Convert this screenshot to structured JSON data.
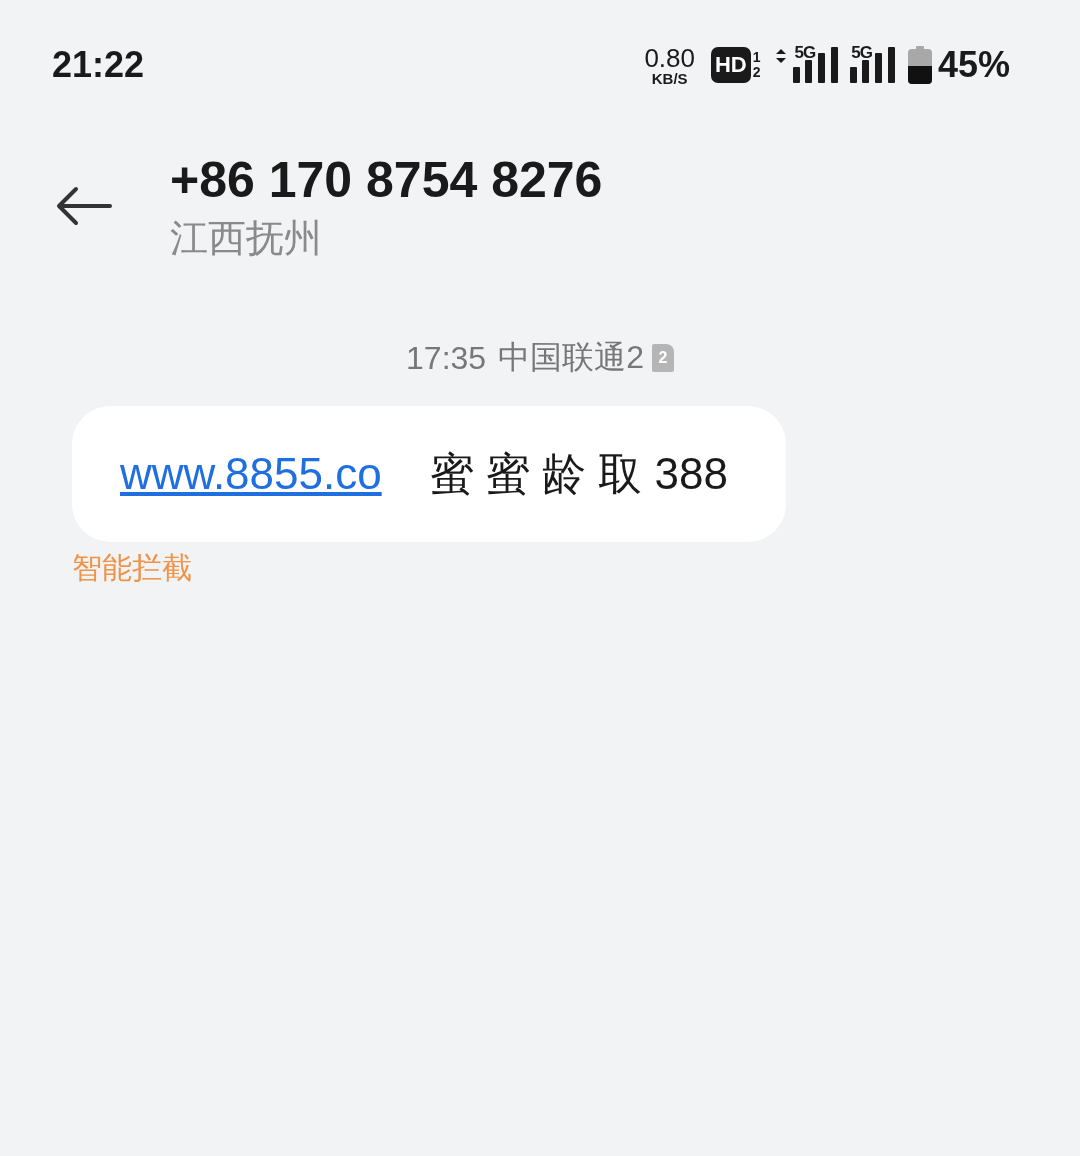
{
  "status_bar": {
    "time": "21:22",
    "net_speed": "0.80",
    "net_unit": "KB/S",
    "hd": "HD",
    "hd_sim_1": "1",
    "hd_sim_2": "2",
    "sim_1_network": "5G",
    "sim_2_network": "5G",
    "battery": "45%"
  },
  "header": {
    "title": "+86 170 8754 8276",
    "subtitle": "江西抚州"
  },
  "messages": [
    {
      "timestamp": "17:35",
      "carrier": "中国联通2",
      "sim": "2",
      "link": "www.8855.co",
      "text": "蜜 蜜 龄 取 388",
      "label": "智能拦截"
    }
  ]
}
